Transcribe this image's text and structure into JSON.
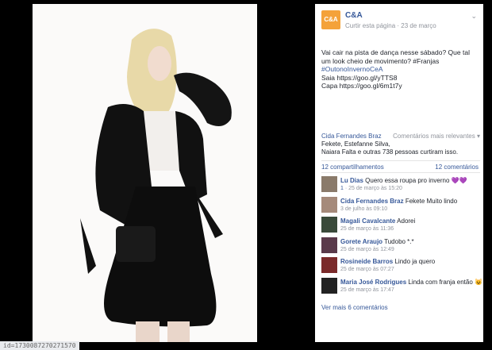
{
  "photo": {
    "alt": "fashion photo"
  },
  "status_url": "id=1730087270271570",
  "page": {
    "logo_text": "C&A",
    "name": "C&A",
    "meta_link": "Curtir esta página",
    "date": "23 de março",
    "chevron": "⌄"
  },
  "post": {
    "lines": [
      {
        "text": "Vai cair na pista de dança nesse sábado? Que tal",
        "blue": false
      },
      {
        "text": "um look cheio de movimento? #Franjas",
        "blue": false
      },
      {
        "text": "#OutonoInvernoCeA",
        "blue": true
      },
      {
        "text": "Saia https://goo.gl/yTTS8",
        "blue": false
      },
      {
        "text": "Capa https://goo.gl/6m1t7y",
        "blue": false
      }
    ]
  },
  "likes": {
    "name": "Cida Fernandes Braz",
    "line2": "Fekete, Estefanne Silva,",
    "line3": "Naiara Falta e outras 738 pessoas curtiram isso.",
    "sort_label": "Comentários mais relevantes ▾"
  },
  "counts": {
    "shares": "12 compartilhamentos",
    "comments": "12 comentários"
  },
  "comments": [
    {
      "name": "Lu Dias",
      "text": "Quero essa roupa pro inverno",
      "emoji": "💜💜",
      "likes": "1",
      "meta": "25 de março às 15:20",
      "avatar": "#8a7a6a"
    },
    {
      "name": "Cida Fernandes Braz",
      "text": "Fekete Muito lindo",
      "emoji": "",
      "likes": "",
      "meta": "3 de julho às 09:10",
      "avatar": "#a58a7a"
    },
    {
      "name": "Magali Cavalcante",
      "text": "Adorei",
      "emoji": "",
      "likes": "",
      "meta": "25 de março às 11:36",
      "avatar": "#3a4a3a"
    },
    {
      "name": "Gorete Araujo",
      "text": "Tudobo *.*",
      "emoji": "",
      "likes": "",
      "meta": "25 de março às 12:49",
      "avatar": "#5a3a4a"
    },
    {
      "name": "Rosineide Barros",
      "text": "Lindo ja quero",
      "emoji": "",
      "likes": "",
      "meta": "25 de março às 07:27",
      "avatar": "#7a2a2a"
    },
    {
      "name": "Maria José Rodrigues",
      "text": "Linda com franja então",
      "emoji": "😺",
      "likes": "",
      "meta": "25 de março às 17:47",
      "avatar": "#222222"
    }
  ],
  "more_comments": "Ver mais 6 comentários"
}
